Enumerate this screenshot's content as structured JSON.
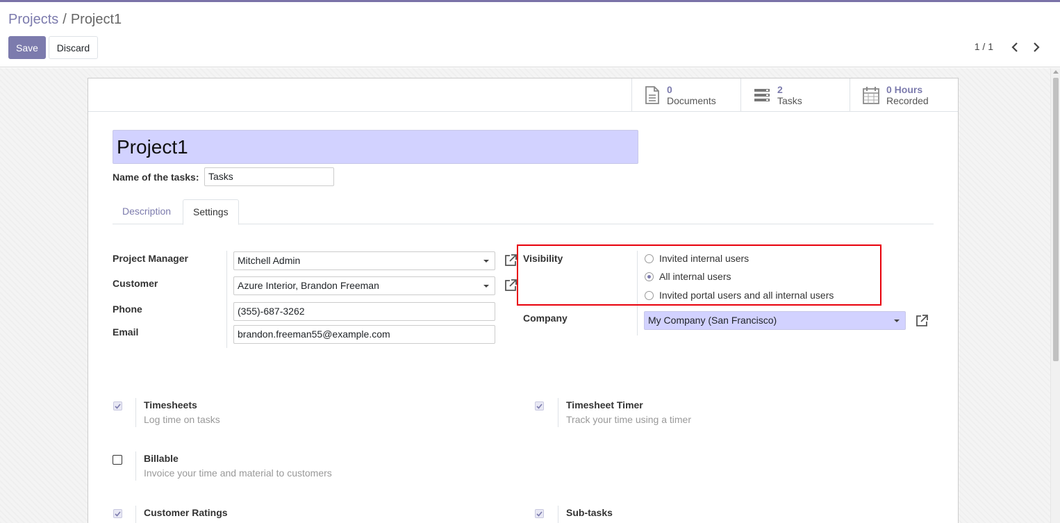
{
  "breadcrumb": {
    "parent": "Projects",
    "separator": "/",
    "current": "Project1"
  },
  "toolbar": {
    "save_label": "Save",
    "discard_label": "Discard"
  },
  "pager": {
    "value": "1 / 1"
  },
  "stats": {
    "documents": {
      "value": "0",
      "label": "Documents",
      "icon": "document-icon"
    },
    "tasks": {
      "value": "2",
      "label": "Tasks",
      "icon": "tasks-icon"
    },
    "hours": {
      "value": "0 Hours",
      "label": "Recorded",
      "icon": "calendar-icon"
    }
  },
  "project": {
    "name": "Project1",
    "tasks_label": "Name of the tasks:",
    "tasks_name": "Tasks"
  },
  "tabs": {
    "description": "Description",
    "settings": "Settings"
  },
  "settings": {
    "manager_label": "Project Manager",
    "manager_value": "Mitchell Admin",
    "customer_label": "Customer",
    "customer_value": "Azure Interior, Brandon Freeman",
    "phone_label": "Phone",
    "phone_value": "(355)-687-3262",
    "email_label": "Email",
    "email_value": "brandon.freeman55@example.com",
    "visibility_label": "Visibility",
    "visibility_options": [
      "Invited internal users",
      "All internal users",
      "Invited portal users and all internal users"
    ],
    "visibility_selected": "All internal users",
    "company_label": "Company",
    "company_value": "My Company (San Francisco)"
  },
  "features": {
    "timesheets": {
      "title": "Timesheets",
      "desc": "Log time on tasks",
      "checked": true
    },
    "timesheet_timer": {
      "title": "Timesheet Timer",
      "desc": "Track your time using a timer",
      "checked": true
    },
    "billable": {
      "title": "Billable",
      "desc": "Invoice your time and material to customers",
      "checked": false
    },
    "customer_ratings": {
      "title": "Customer Ratings",
      "checked": true
    },
    "subtasks": {
      "title": "Sub-tasks",
      "checked": true
    }
  },
  "colors": {
    "accent": "#7c7bad",
    "title_bg": "#d2d2ff",
    "highlight": "#e8000b"
  }
}
